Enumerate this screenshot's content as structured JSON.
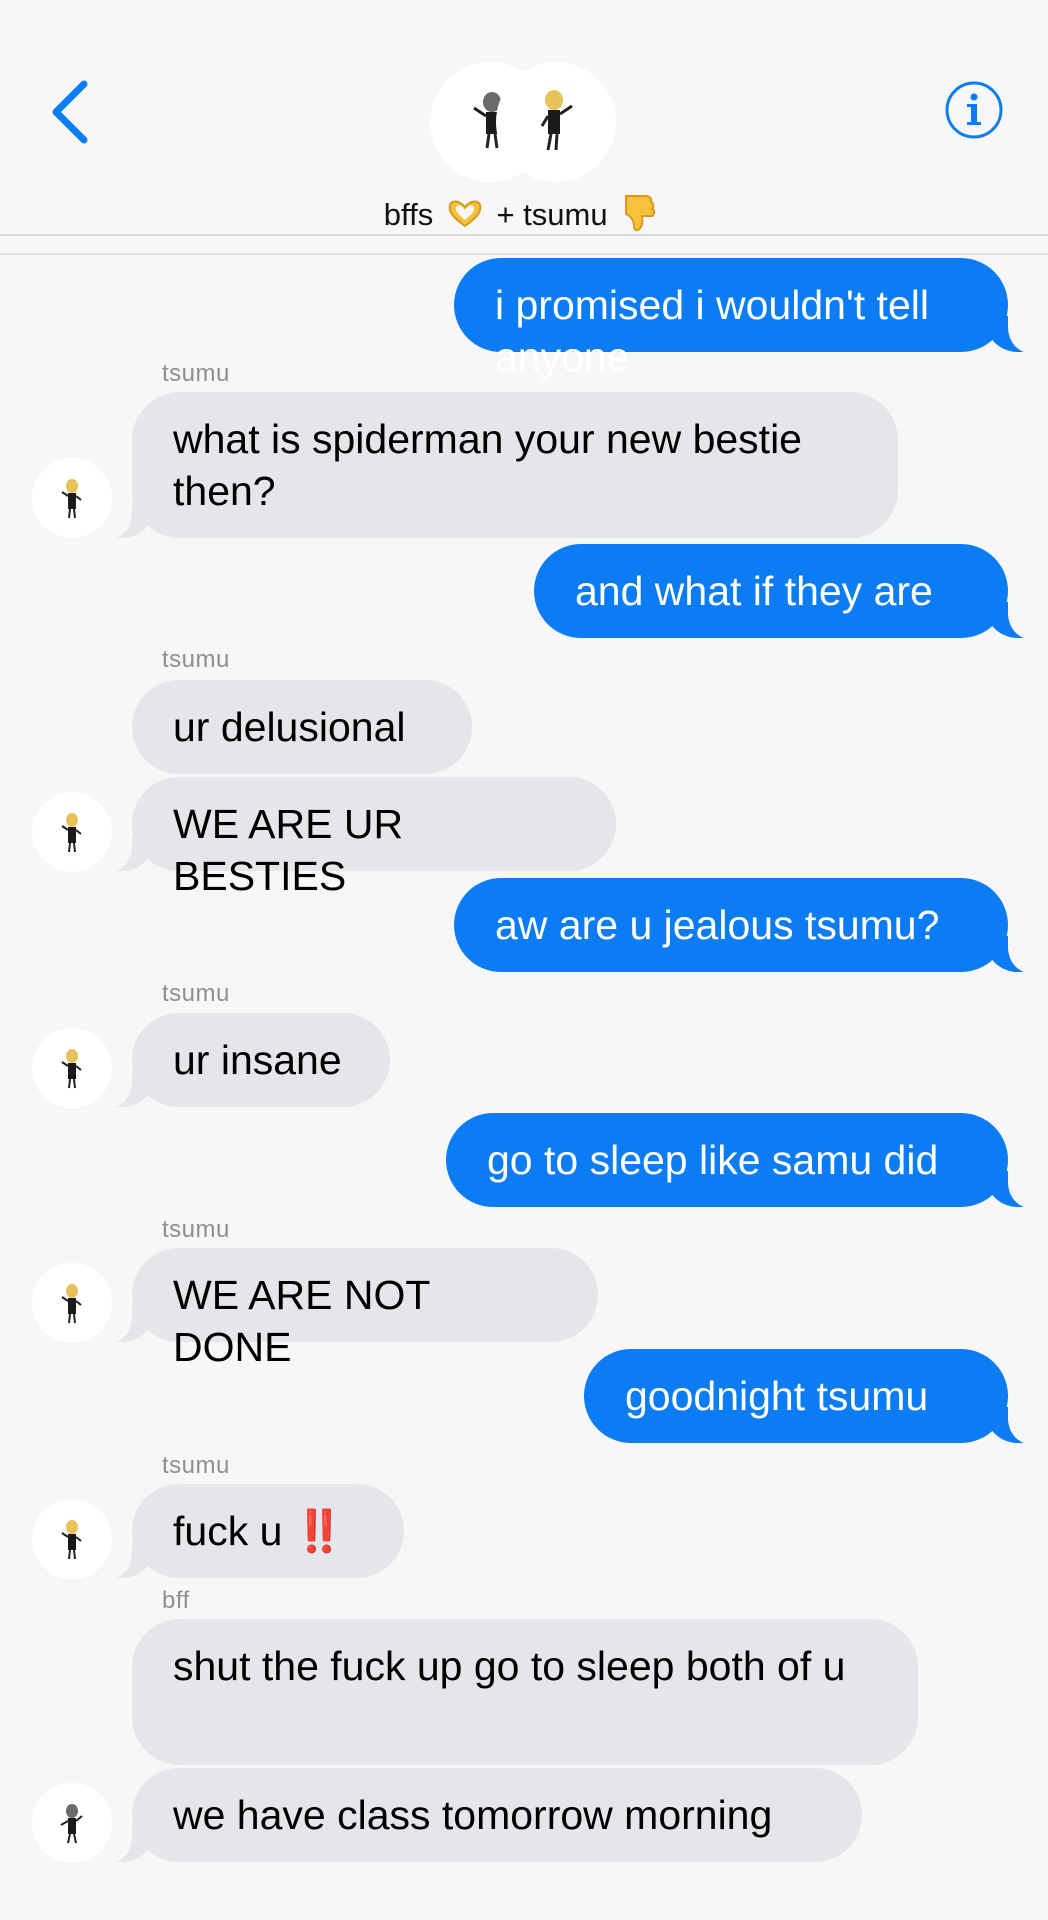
{
  "header": {
    "group_name": "bffs",
    "group_suffix": "+ tsumu",
    "heart_hands_emoji": "🫶",
    "thumbs_down_emoji": "👎",
    "back_icon": "chevron-left-icon",
    "info_icon": "info-icon",
    "accent_color": "#0b7cf4"
  },
  "messages": [
    {
      "dir": "out",
      "text": "i promised i wouldn't tell anyone"
    },
    {
      "dir": "in",
      "sender": "tsumu",
      "text": "what is spiderman your new bestie then?"
    },
    {
      "dir": "out",
      "text": "and what if they are"
    },
    {
      "dir": "in",
      "sender": "tsumu",
      "text": "ur delusional"
    },
    {
      "dir": "in",
      "text": "WE ARE UR BESTIES"
    },
    {
      "dir": "out",
      "text": "aw are u jealous tsumu?"
    },
    {
      "dir": "in",
      "sender": "tsumu",
      "text": "ur insane"
    },
    {
      "dir": "out",
      "text": "go to sleep like samu did"
    },
    {
      "dir": "in",
      "sender": "tsumu",
      "text": "WE ARE NOT DONE"
    },
    {
      "dir": "out",
      "text": "goodnight tsumu"
    },
    {
      "dir": "in",
      "sender": "tsumu",
      "text": "fuck u",
      "emoji": "‼️"
    },
    {
      "dir": "in",
      "sender": "bff",
      "text": "shut the fuck up go to sleep both of u"
    },
    {
      "dir": "in",
      "text": "we have class tomorrow morning"
    }
  ],
  "colors": {
    "outgoing_bubble": "#0b7cf4",
    "incoming_bubble": "#e5e5ea",
    "sender_label": "#8e8e93",
    "background": "#f7f7f8"
  }
}
